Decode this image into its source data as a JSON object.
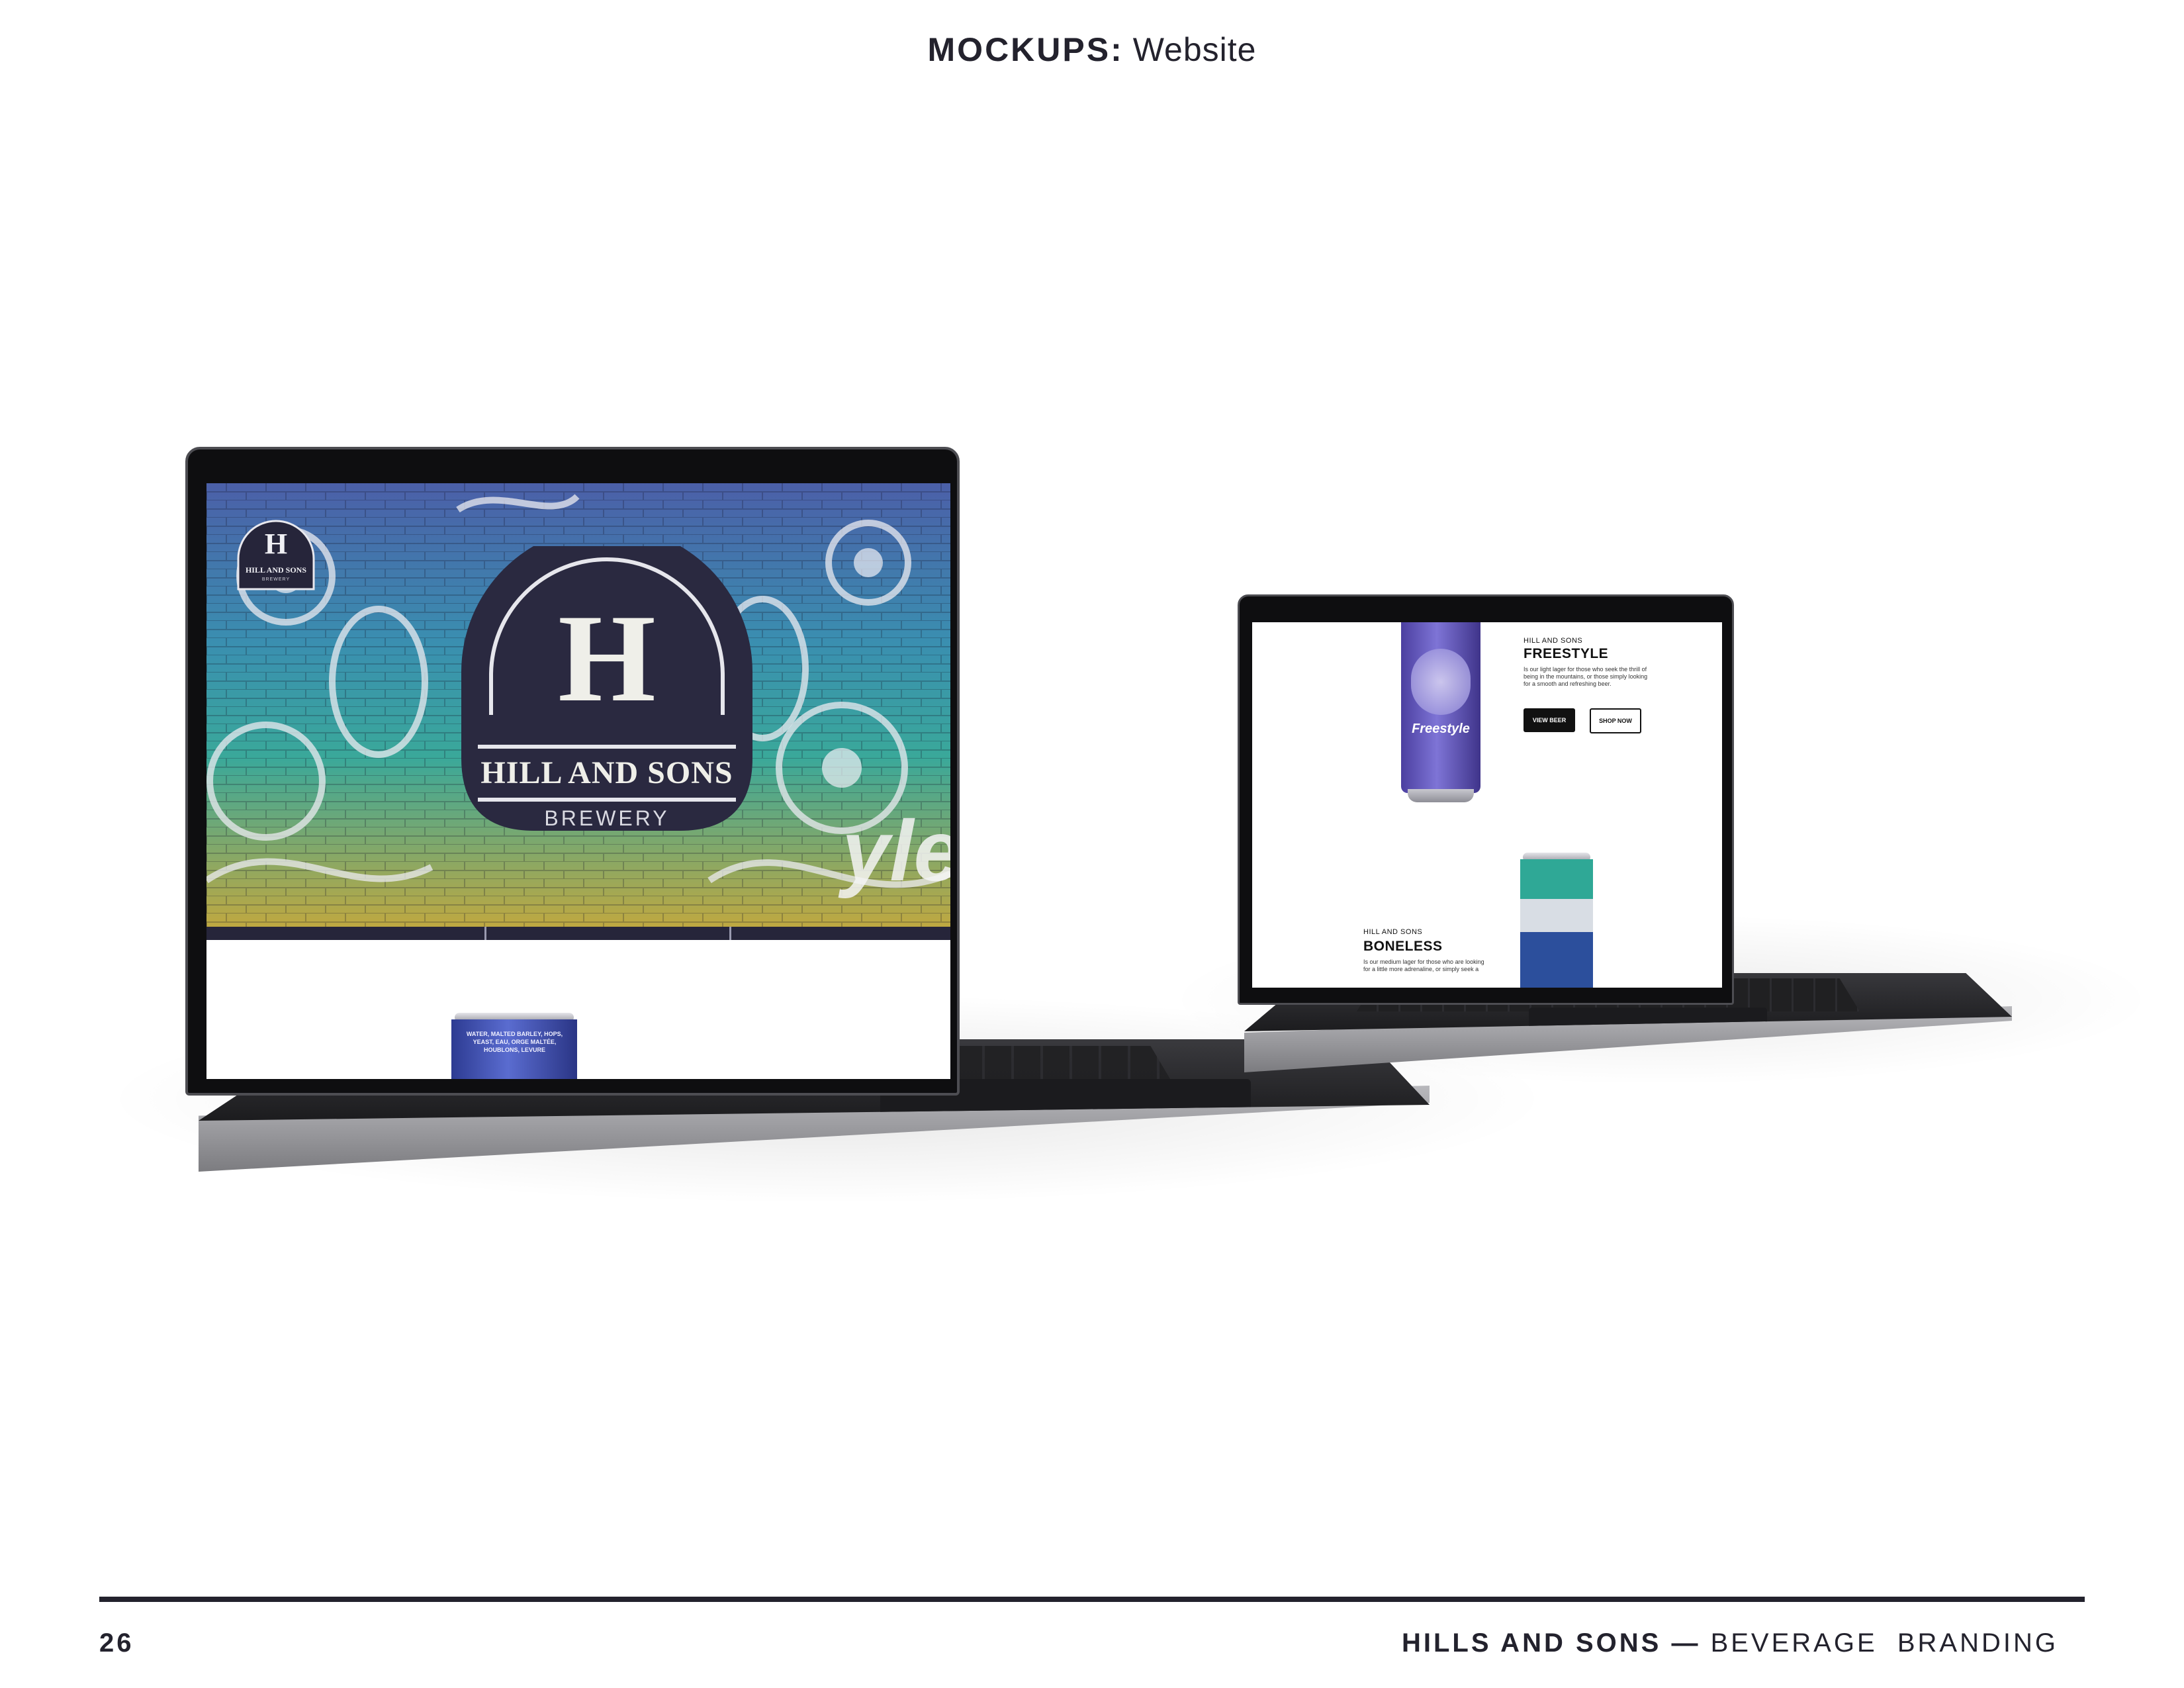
{
  "header": {
    "bold": "MOCKUPS:",
    "light": "Website"
  },
  "laptop_large": {
    "logo_small": {
      "letter": "H",
      "name": "HILL AND SONS",
      "sub": "BREWERY"
    },
    "logo_big": {
      "letter": "H",
      "name": "HILL AND SONS",
      "sub": "BREWERY"
    },
    "mural_text": "yle",
    "can_text": "WATER, MALTED BARLEY, HOPS, YEAST, EAU, ORGE MALTÉE, HOUBLONS, LEVURE"
  },
  "laptop_small": {
    "beer1": {
      "eyebrow": "HILL AND SONS",
      "name": "FREESTYLE",
      "desc": "Is our light lager for those who seek the thrill of being in the mountains, or those simply looking for a smooth and refreshing beer.",
      "can_label": "Freestyle",
      "buttons": {
        "view": "VIEW BEER",
        "shop": "SHOP NOW"
      }
    },
    "beer2": {
      "eyebrow": "HILL AND SONS",
      "name": "BONELESS",
      "desc": "Is our medium lager for those who are looking for a little more adrenaline, or simply seek a"
    }
  },
  "colors": {
    "ink": "#23222d",
    "navy": "#2b2b44",
    "teal": "#3aa8a8",
    "gold": "#c9a83a"
  },
  "footer": {
    "page": "26",
    "brand": "HILLS AND SONS",
    "dash": "—",
    "section": "BEVERAGE  BRANDING"
  }
}
